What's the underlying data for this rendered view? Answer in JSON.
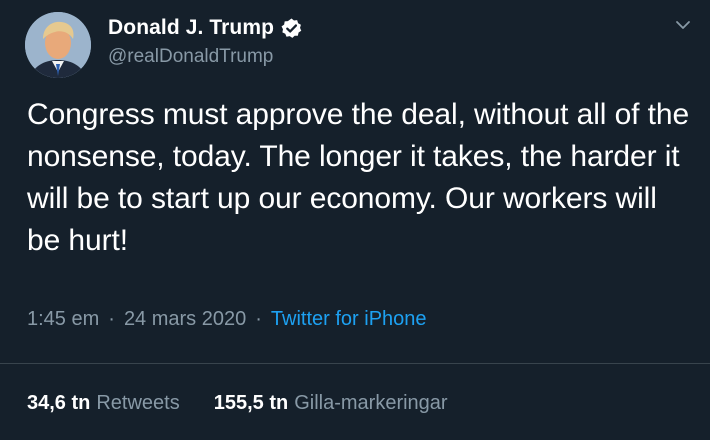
{
  "author": {
    "display_name": "Donald J. Trump",
    "handle": "@realDonaldTrump",
    "verified": true
  },
  "tweet": {
    "text": "Congress must approve the deal, without all of the nonsense, today. The longer it takes, the harder it will be to start up our economy. Our workers will be hurt!",
    "time": "1:45 em",
    "date": "24 mars 2020",
    "separator": "·",
    "source": "Twitter for iPhone"
  },
  "stats": {
    "retweets_count": "34,6 tn",
    "retweets_label": "Retweets",
    "likes_count": "155,5 tn",
    "likes_label": "Gilla-markeringar"
  },
  "icons": {
    "verified": "verified-badge-icon",
    "menu": "chevron-down-icon"
  },
  "colors": {
    "background": "#15202b",
    "primary_text": "#ffffff",
    "secondary_text": "#8899a6",
    "link": "#1da1f2",
    "divider": "#38444d"
  }
}
